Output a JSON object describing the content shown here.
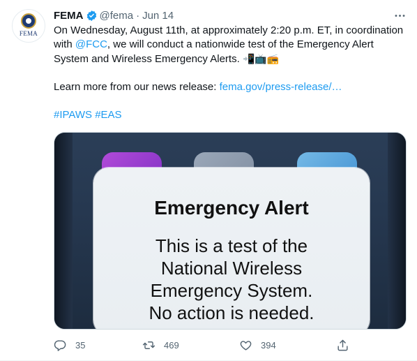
{
  "account": {
    "avatar_text": "FEMA",
    "name": "FEMA",
    "handle": "@fema",
    "separator": "·",
    "date": "Jun 14"
  },
  "tweet": {
    "text_part1": "On Wednesday, August 11th, at approximately 2:20 p.m. ET, in coordination with ",
    "mention": "@FCC",
    "text_part2": ", we will conduct a nationwide test of the Emergency Alert System and Wireless Emergency Alerts. ",
    "emojis": "📲📺📻",
    "learn_more": "Learn more from our news release: ",
    "link_text": "fema.gov/press-release/…",
    "hashtag1": "#IPAWS",
    "hashtag2": "#EAS"
  },
  "media": {
    "alert_title": "Emergency Alert",
    "alert_body": "This is a test of the\nNational Wireless\nEmergency System.\nNo action is needed."
  },
  "actions": {
    "reply_count": "35",
    "retweet_count": "469",
    "like_count": "394"
  },
  "icons": {
    "verified": "verified-badge-icon",
    "more": "more-icon",
    "reply": "reply-icon",
    "retweet": "retweet-icon",
    "like": "heart-icon",
    "share": "share-icon"
  },
  "colors": {
    "accent": "#1d9bf0",
    "text": "#0f1419",
    "muted": "#536471"
  }
}
